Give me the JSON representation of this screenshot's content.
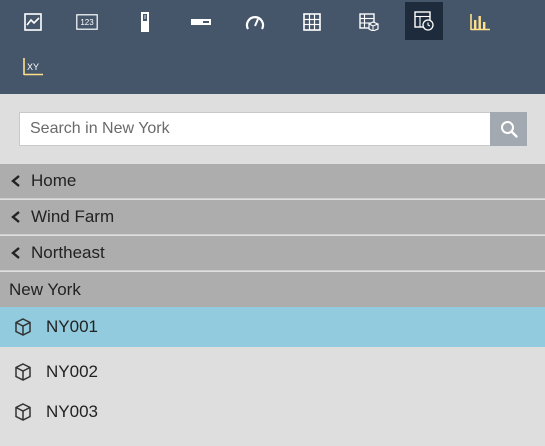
{
  "toolbar": {
    "buttons": [
      {
        "icon": "line-chart-icon",
        "active": false
      },
      {
        "icon": "numeric-display-icon",
        "label": "123",
        "active": false
      },
      {
        "icon": "vertical-gauge-icon",
        "active": false
      },
      {
        "icon": "horizontal-gauge-icon",
        "active": false
      },
      {
        "icon": "radial-gauge-icon",
        "active": false
      },
      {
        "icon": "table-icon",
        "active": false
      },
      {
        "icon": "asset-table-icon",
        "active": false
      },
      {
        "icon": "status-table-icon",
        "active": true
      },
      {
        "icon": "bar-chart-icon",
        "active": false
      },
      {
        "icon": "xy-plot-icon",
        "label": "XY",
        "active": false
      }
    ]
  },
  "search": {
    "placeholder": "Search in New York",
    "icon": "search-icon"
  },
  "breadcrumbs": [
    {
      "label": "Home",
      "icon": "chevron-left-icon"
    },
    {
      "label": "Wind Farm",
      "icon": "chevron-left-icon"
    },
    {
      "label": "Northeast",
      "icon": "chevron-left-icon"
    }
  ],
  "current_location": "New York",
  "assets": [
    {
      "label": "NY001",
      "icon": "asset-cube-icon",
      "selected": true
    },
    {
      "label": "NY002",
      "icon": "asset-cube-icon",
      "selected": false
    },
    {
      "label": "NY003",
      "icon": "asset-cube-icon",
      "selected": false
    }
  ],
  "colors": {
    "toolbar_bg": "#45556a",
    "toolbar_active": "#1e2b3c",
    "breadcrumb_bg": "#adadad",
    "selected_row": "#92cbde",
    "panel_bg": "#dedede"
  }
}
